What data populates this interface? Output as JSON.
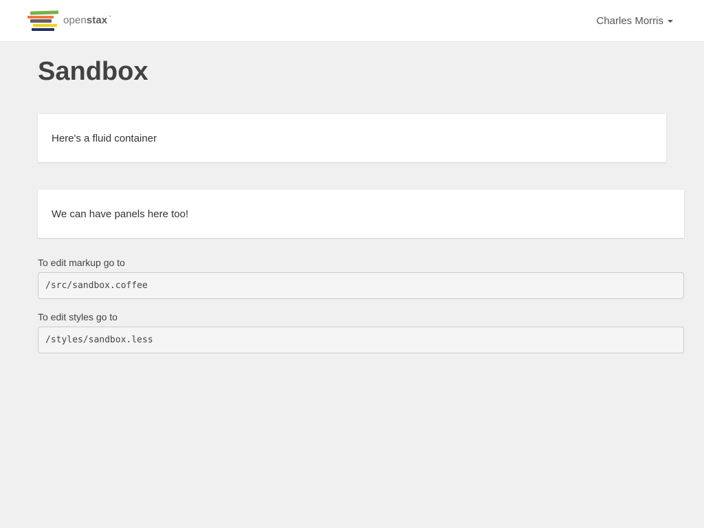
{
  "header": {
    "brand": {
      "name_light": "open",
      "name_bold": "stax",
      "trademark": "™"
    },
    "user_menu": {
      "name": "Charles Morris"
    }
  },
  "main": {
    "title": "Sandbox",
    "fluid_container_text": "Here's a fluid container",
    "panel_text": "We can have panels here too!",
    "markup_label": "To edit markup go to",
    "markup_path": "/src/sandbox.coffee",
    "styles_label": "To edit styles go to",
    "styles_path": "/styles/sandbox.less"
  },
  "colors": {
    "background": "#f0f0f0",
    "navbar": "#ffffff",
    "text": "#424242",
    "logo_green": "#78b04a",
    "logo_orange": "#f47641",
    "logo_gray": "#5f6163",
    "logo_yellow": "#f4d019",
    "logo_navy": "#232e66"
  }
}
